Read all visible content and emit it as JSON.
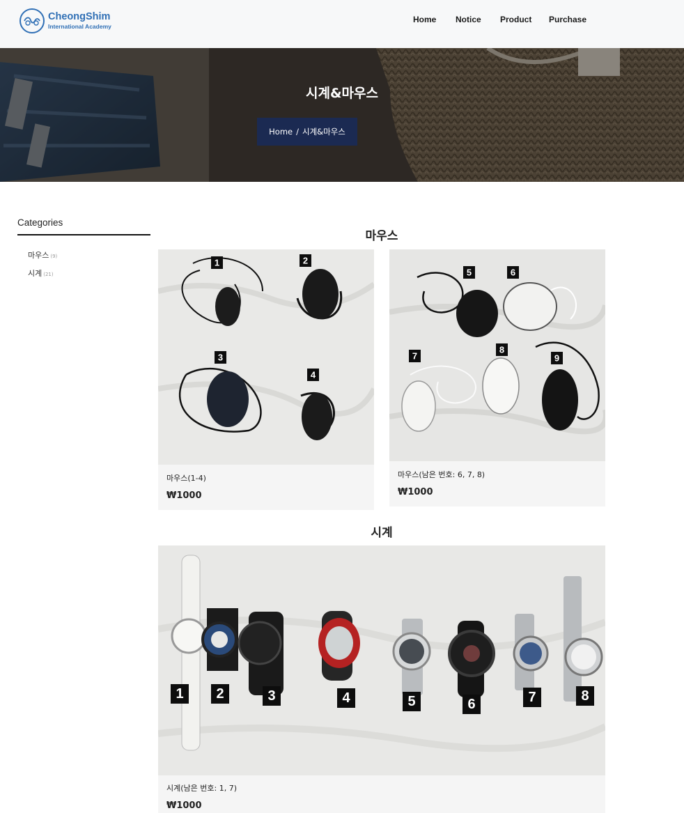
{
  "brand": {
    "name": "CheongShim",
    "subtitle": "International Academy",
    "primary_color": "#2f6fb5"
  },
  "nav": {
    "items": [
      {
        "label": "Home"
      },
      {
        "label": "Notice"
      },
      {
        "label": "Product"
      },
      {
        "label": "Purchase"
      }
    ]
  },
  "hero": {
    "title": "시계&마우스",
    "breadcrumb": {
      "home": "Home",
      "separator": "/",
      "current": "시계&마우스"
    },
    "breadcrumb_bg_color": "#1b2a52"
  },
  "sidebar": {
    "title": "Categories",
    "items": [
      {
        "label": "마우스",
        "count": "(9)"
      },
      {
        "label": "시계",
        "count": "(21)"
      }
    ]
  },
  "sections": [
    {
      "heading": "마우스",
      "products": [
        {
          "name": "마우스(1-4)",
          "price": "₩1000",
          "photo_labels": [
            "1",
            "2",
            "3",
            "4"
          ]
        },
        {
          "name": "마우스(남은 번호: 6, 7, 8)",
          "price": "₩1000",
          "photo_labels": [
            "5",
            "6",
            "7",
            "8",
            "9"
          ]
        }
      ]
    },
    {
      "heading": "시계",
      "products": [
        {
          "name": "시계(남은 번호: 1, 7)",
          "price": "₩1000",
          "photo_labels": [
            "1",
            "2",
            "3",
            "4",
            "5",
            "6",
            "7",
            "8"
          ]
        }
      ]
    }
  ]
}
